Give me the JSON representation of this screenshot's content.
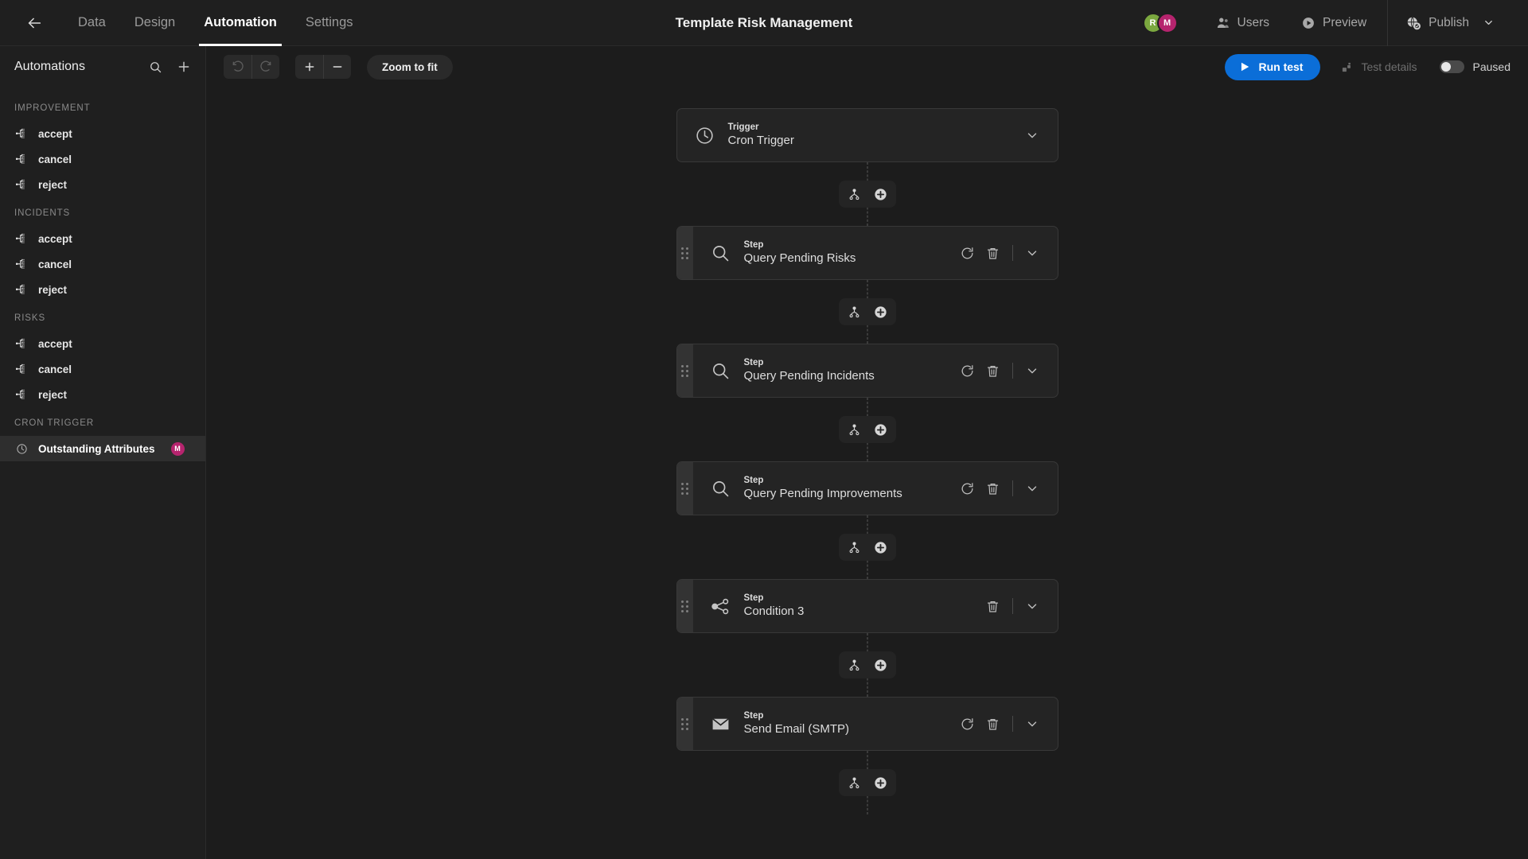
{
  "header": {
    "back_icon": "arrow-left-icon",
    "title": "Template Risk Management",
    "tabs": [
      {
        "label": "Data",
        "active": false
      },
      {
        "label": "Design",
        "active": false
      },
      {
        "label": "Automation",
        "active": true
      },
      {
        "label": "Settings",
        "active": false
      }
    ],
    "avatars": [
      {
        "initial": "R",
        "color": "#7ba83f"
      },
      {
        "initial": "M",
        "color": "#b6246e"
      }
    ],
    "users_label": "Users",
    "preview_label": "Preview",
    "publish_label": "Publish"
  },
  "sidebar": {
    "title": "Automations",
    "search_icon": "search-icon",
    "add_icon": "plus-icon",
    "groups": [
      {
        "label": "IMPROVEMENT",
        "items": [
          {
            "label": "accept",
            "icon": "flow-icon",
            "selected": false
          },
          {
            "label": "cancel",
            "icon": "flow-icon",
            "selected": false
          },
          {
            "label": "reject",
            "icon": "flow-icon",
            "selected": false
          }
        ]
      },
      {
        "label": "INCIDENTS",
        "items": [
          {
            "label": "accept",
            "icon": "flow-icon",
            "selected": false
          },
          {
            "label": "cancel",
            "icon": "flow-icon",
            "selected": false
          },
          {
            "label": "reject",
            "icon": "flow-icon",
            "selected": false
          }
        ]
      },
      {
        "label": "RISKS",
        "items": [
          {
            "label": "accept",
            "icon": "flow-icon",
            "selected": false
          },
          {
            "label": "cancel",
            "icon": "flow-icon",
            "selected": false
          },
          {
            "label": "reject",
            "icon": "flow-icon",
            "selected": false
          }
        ]
      },
      {
        "label": "CRON TRIGGER",
        "items": [
          {
            "label": "Outstanding Attributes",
            "icon": "clock-icon",
            "selected": true,
            "badge": "M",
            "badge_color": "#b6246e"
          }
        ]
      }
    ]
  },
  "toolbar": {
    "undo_icon": "undo-icon",
    "redo_icon": "redo-icon",
    "zoom_in_icon": "plus-icon",
    "zoom_out_icon": "minus-icon",
    "zoom_to_fit_label": "Zoom to fit",
    "run_test_label": "Run test",
    "run_test_icon": "play-icon",
    "run_test_color": "#0b6ed8",
    "test_details_label": "Test details",
    "test_details_icon": "steps-icon",
    "toggle_state": "off",
    "toggle_label": "Paused"
  },
  "flow": {
    "connector": {
      "branch_icon": "branch-icon",
      "add_icon": "circle-plus-icon"
    },
    "nodes": [
      {
        "kind": "Trigger",
        "name": "Cron Trigger",
        "icon": "clock-icon",
        "has_drag_handle": false,
        "has_refresh": false,
        "has_delete": false
      },
      {
        "kind": "Step",
        "name": "Query Pending Risks",
        "icon": "search-icon",
        "has_drag_handle": true,
        "has_refresh": true,
        "has_delete": true
      },
      {
        "kind": "Step",
        "name": "Query Pending Incidents",
        "icon": "search-icon",
        "has_drag_handle": true,
        "has_refresh": true,
        "has_delete": true
      },
      {
        "kind": "Step",
        "name": "Query Pending Improvements",
        "icon": "search-icon",
        "has_drag_handle": true,
        "has_refresh": true,
        "has_delete": true
      },
      {
        "kind": "Step",
        "name": "Condition 3",
        "icon": "branch-share-icon",
        "has_drag_handle": true,
        "has_refresh": false,
        "has_delete": true
      },
      {
        "kind": "Step",
        "name": "Send Email (SMTP)",
        "icon": "envelope-icon",
        "has_drag_handle": true,
        "has_refresh": true,
        "has_delete": true
      }
    ]
  }
}
